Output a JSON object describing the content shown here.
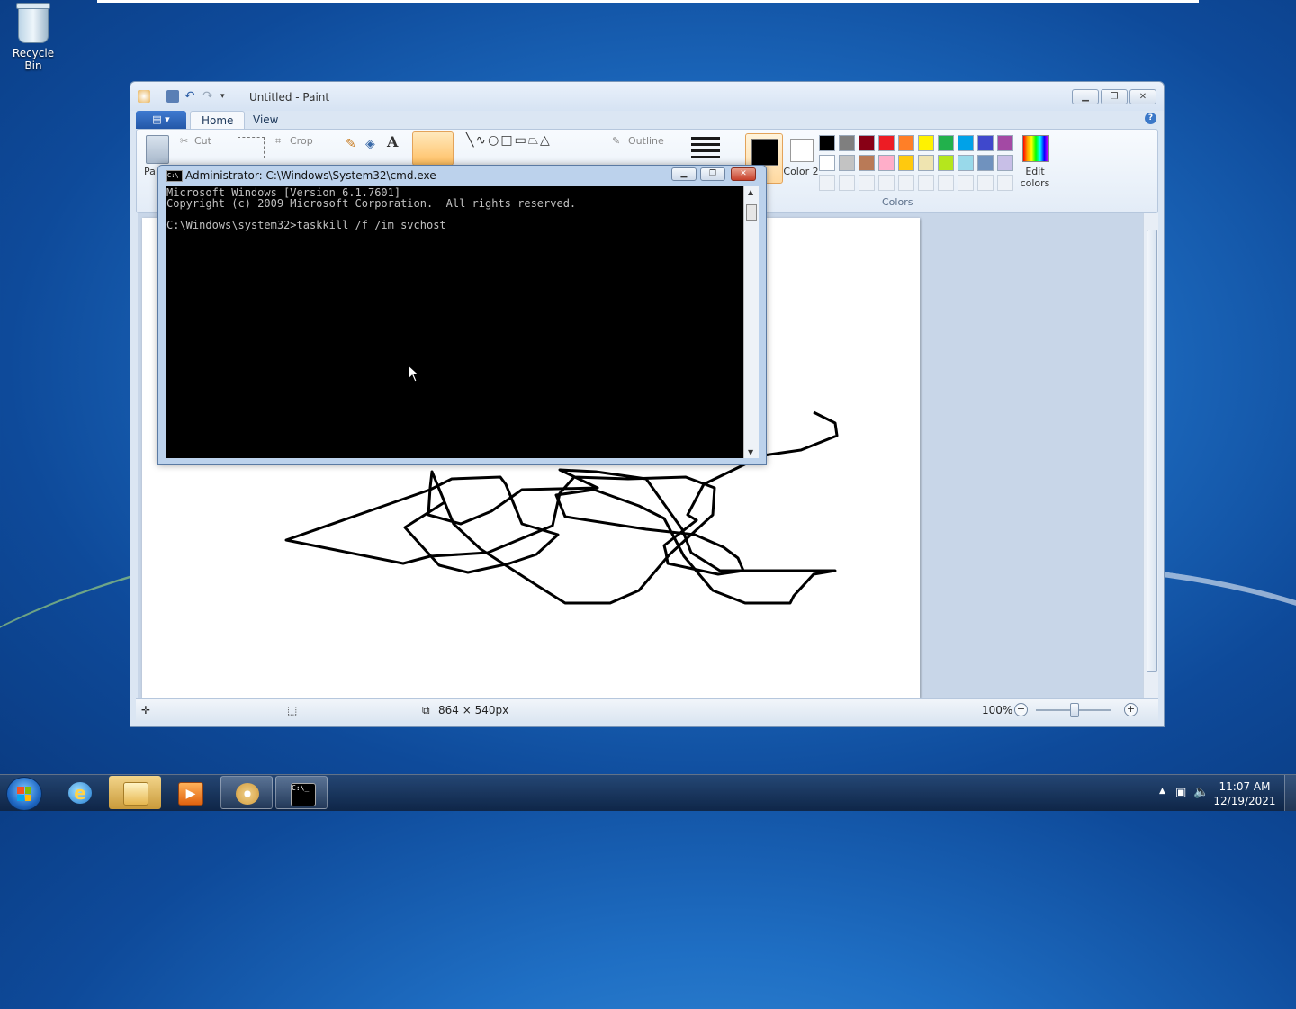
{
  "desktop": {
    "recycle_bin_label": "Recycle Bin"
  },
  "paint": {
    "title": "Untitled - Paint",
    "tabs": [
      "Home",
      "View"
    ],
    "clipboard": {
      "paste": "Pa",
      "cut": "Cut"
    },
    "image": {
      "crop": "Crop"
    },
    "shapes": {
      "outline": "Outline"
    },
    "color2_label": "Color 2",
    "colors_group_label": "Colors",
    "edit_colors_label": "Edit colors",
    "palette_row1": [
      "#000000",
      "#7f7f7f",
      "#880015",
      "#ed1c24",
      "#ff7f27",
      "#fff200",
      "#22b14c",
      "#00a2e8",
      "#3f48cc",
      "#a349a4"
    ],
    "palette_row2": [
      "#ffffff",
      "#c3c3c3",
      "#b97a57",
      "#ffaec9",
      "#ffc90e",
      "#efe4b0",
      "#b5e61d",
      "#99d9ea",
      "#7092be",
      "#c8bfe7"
    ],
    "status": {
      "dimensions": "864 × 540px",
      "zoom": "100%"
    }
  },
  "cmd": {
    "title": "Administrator: C:\\Windows\\System32\\cmd.exe",
    "lines": [
      "Microsoft Windows [Version 6.1.7601]",
      "Copyright (c) 2009 Microsoft Corporation.  All rights reserved.",
      "",
      "C:\\Windows\\system32>taskkill /f /im svchost"
    ]
  },
  "taskbar": {
    "time": "11:07 AM",
    "date": "12/19/2021"
  }
}
